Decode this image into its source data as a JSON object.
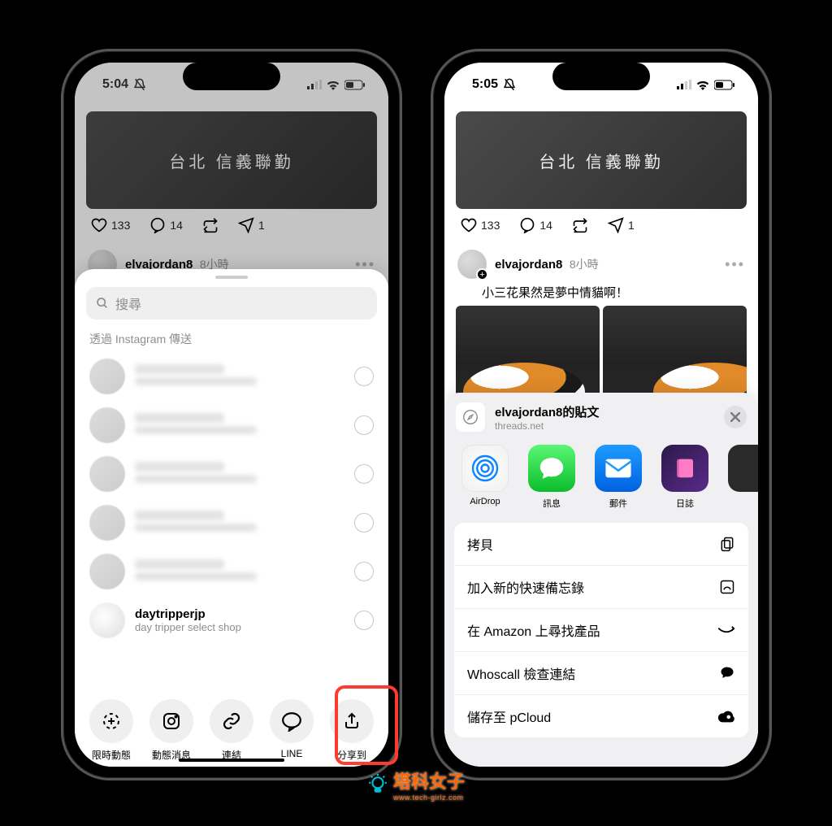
{
  "left": {
    "status": {
      "time": "5:04"
    },
    "post": {
      "media_text": "台北 信義聯勤",
      "like_count": "133",
      "comment_count": "14",
      "repost_count": "",
      "share_count": "1",
      "username": "elvajordan8",
      "time": "8小時"
    },
    "sheet": {
      "search_placeholder": "搜尋",
      "section_title": "透過 Instagram 傳送",
      "daytripper": {
        "name": "daytripperjp",
        "sub": "day tripper select shop"
      },
      "share_opts": {
        "story": "限時動態",
        "feed": "動態消息",
        "link": "連結",
        "line": "LINE",
        "shareto": "分享到"
      }
    }
  },
  "right": {
    "status": {
      "time": "5:05"
    },
    "post": {
      "media_text": "台北 信義聯勤",
      "like_count": "133",
      "comment_count": "14",
      "share_count": "1",
      "username": "elvajordan8",
      "time": "8小時",
      "caption": "小三花果然是夢中情貓啊！"
    },
    "ios_sheet": {
      "title": "elvajordan8的貼文",
      "subtitle": "threads.net",
      "apps": {
        "airdrop": "AirDrop",
        "messages": "訊息",
        "mail": "郵件",
        "journal": "日誌"
      },
      "actions": {
        "copy": "拷貝",
        "quicknote": "加入新的快速備忘錄",
        "amazon": "在 Amazon 上尋找產品",
        "whoscall": "Whoscall 檢查連結",
        "pcloud": "儲存至 pCloud"
      }
    }
  },
  "watermark": {
    "title": "塔科女子",
    "sub": "www.tech-girlz.com"
  }
}
